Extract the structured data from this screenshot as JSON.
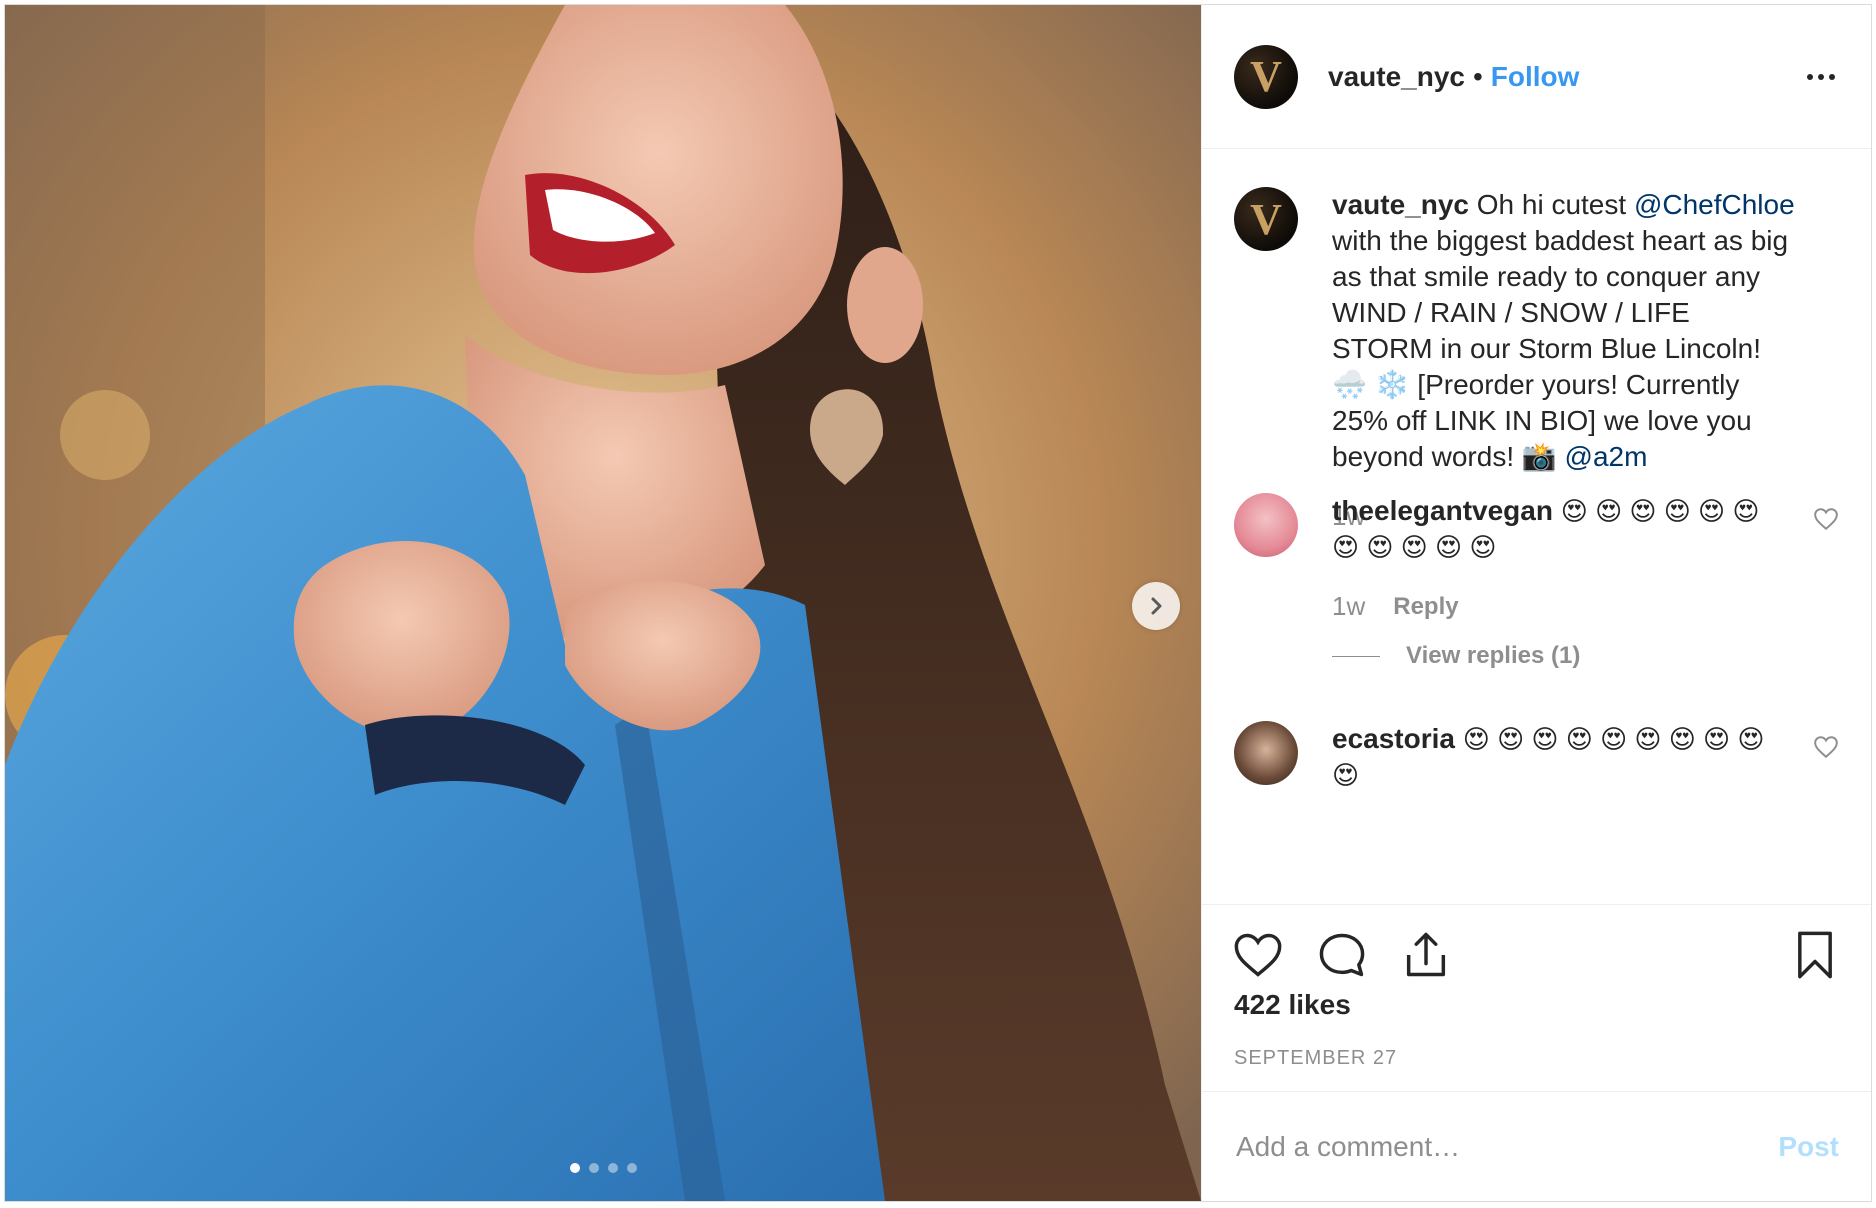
{
  "post": {
    "author": "vaute_nyc",
    "separator": "•",
    "follow_label": "Follow",
    "avatar_letter": "V"
  },
  "caption": {
    "username": "vaute_nyc",
    "text_1": "Oh hi cutest",
    "mention_1": "@ChefChloe",
    "text_2": "with the biggest baddest heart as big as that smile ready to conquer any WIND / RAIN / SNOW / LIFE STORM in our Storm Blue Lincoln! 🌨️ ❄️ [Preorder yours! Currently 25% off LINK IN BIO] we love you beyond words! 📸",
    "mention_2": "@a2m",
    "time": "1w"
  },
  "comments": [
    {
      "username": "theelegantvegan",
      "text": "😍 😍 😍 😍 😍 😍 😍 😍 😍 😍 😍",
      "time": "1w",
      "reply_label": "Reply",
      "view_replies_label": "View replies (1)"
    },
    {
      "username": "ecastoria",
      "text": "😍 😍 😍 😍 😍 😍 😍 😍 😍 😍"
    }
  ],
  "likes": "422 likes",
  "date": "SEPTEMBER 27",
  "comment_box": {
    "placeholder": "Add a comment…",
    "post_label": "Post"
  },
  "carousel": {
    "count": 4,
    "active": 1
  },
  "colors": {
    "link": "#3897f0",
    "mention": "#003569",
    "muted": "#8e8e8e",
    "post_disabled": "#b2dffc"
  }
}
